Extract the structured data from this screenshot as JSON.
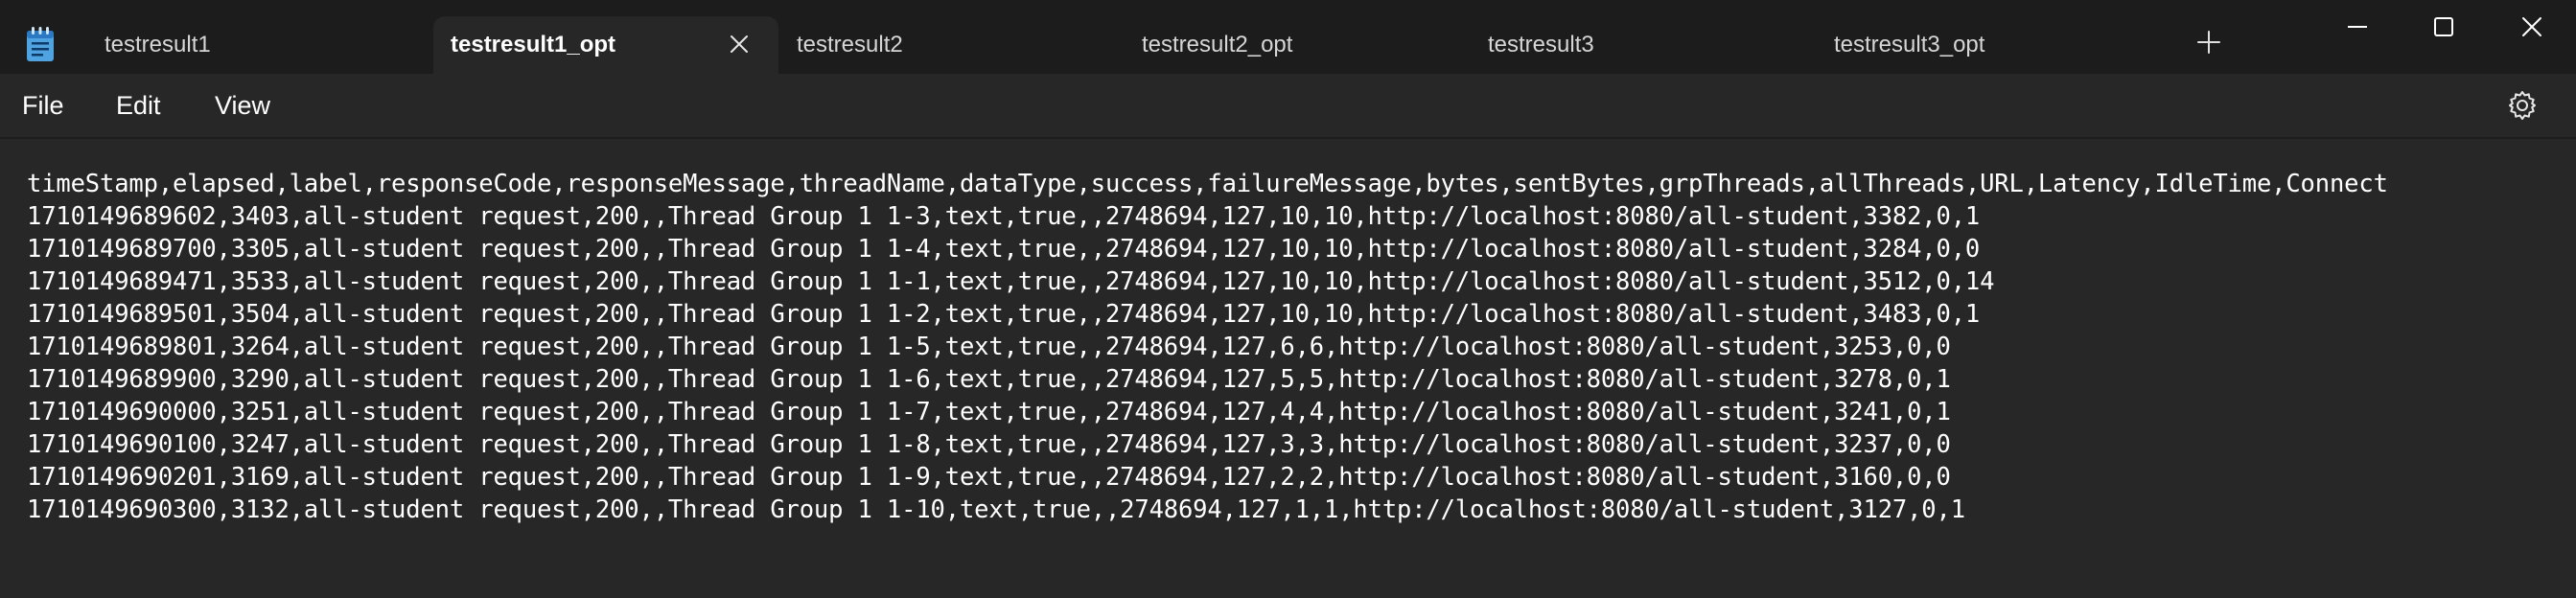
{
  "tabs": [
    {
      "label": "testresult1",
      "active": false
    },
    {
      "label": "testresult1_opt",
      "active": true
    },
    {
      "label": "testresult2",
      "active": false
    },
    {
      "label": "testresult2_opt",
      "active": false
    },
    {
      "label": "testresult3",
      "active": false
    },
    {
      "label": "testresult3_opt",
      "active": false
    }
  ],
  "icons": {
    "app": "notepad-icon",
    "tab_close": "close-icon",
    "new_tab": "plus-icon",
    "minimize": "minimize-icon",
    "maximize": "maximize-icon",
    "close": "close-icon",
    "settings": "gear-icon"
  },
  "menu": {
    "file": "File",
    "edit": "Edit",
    "view": "View"
  },
  "document": {
    "lines": [
      "timeStamp,elapsed,label,responseCode,responseMessage,threadName,dataType,success,failureMessage,bytes,sentBytes,grpThreads,allThreads,URL,Latency,IdleTime,Connect",
      "1710149689602,3403,all-student request,200,,Thread Group 1 1-3,text,true,,2748694,127,10,10,http://localhost:8080/all-student,3382,0,1",
      "1710149689700,3305,all-student request,200,,Thread Group 1 1-4,text,true,,2748694,127,10,10,http://localhost:8080/all-student,3284,0,0",
      "1710149689471,3533,all-student request,200,,Thread Group 1 1-1,text,true,,2748694,127,10,10,http://localhost:8080/all-student,3512,0,14",
      "1710149689501,3504,all-student request,200,,Thread Group 1 1-2,text,true,,2748694,127,10,10,http://localhost:8080/all-student,3483,0,1",
      "1710149689801,3264,all-student request,200,,Thread Group 1 1-5,text,true,,2748694,127,6,6,http://localhost:8080/all-student,3253,0,0",
      "1710149689900,3290,all-student request,200,,Thread Group 1 1-6,text,true,,2748694,127,5,5,http://localhost:8080/all-student,3278,0,1",
      "1710149690000,3251,all-student request,200,,Thread Group 1 1-7,text,true,,2748694,127,4,4,http://localhost:8080/all-student,3241,0,1",
      "1710149690100,3247,all-student request,200,,Thread Group 1 1-8,text,true,,2748694,127,3,3,http://localhost:8080/all-student,3237,0,0",
      "1710149690201,3169,all-student request,200,,Thread Group 1 1-9,text,true,,2748694,127,2,2,http://localhost:8080/all-student,3160,0,0",
      "1710149690300,3132,all-student request,200,,Thread Group 1 1-10,text,true,,2748694,127,1,1,http://localhost:8080/all-student,3127,0,1"
    ]
  }
}
